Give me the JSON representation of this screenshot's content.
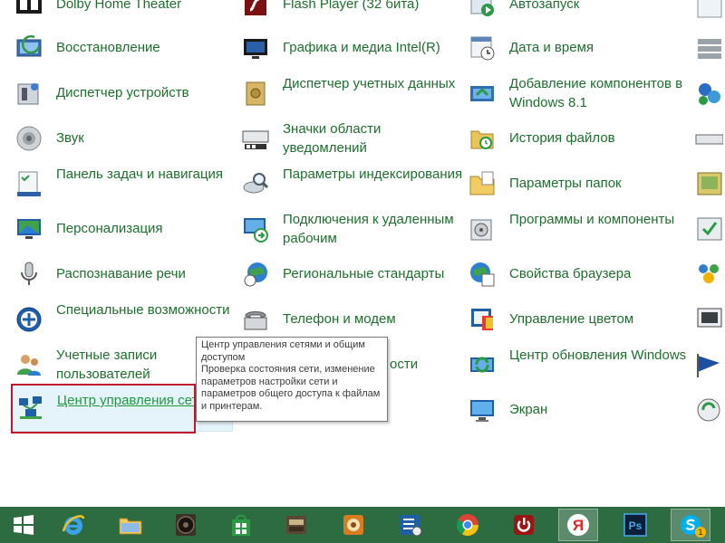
{
  "control_panel": {
    "items": {
      "dolby": "Dolby Home Theater",
      "flash": "Flash Player (32 бита)",
      "autoplay": "Автозапуск",
      "recovery": "Восстановление",
      "intel_graphics": "Графика и медиа Intel(R)",
      "date_time": "Дата и время",
      "device_manager": "Диспетчер устройств",
      "credential_manager": "Диспетчер учетных данных",
      "add_features": "Добавление компонентов в Windows 8.1",
      "sound": "Звук",
      "notification_icons": "Значки области уведомлений",
      "file_history": "История файлов",
      "taskbar_nav": "Панель задач и навигация",
      "indexing": "Параметры индексирования",
      "folder_options": "Параметры папок",
      "personalization": "Персонализация",
      "remote_connections": "Подключения к удаленным рабочим",
      "programs": "Программы и компоненты",
      "speech": "Распознавание речи",
      "regional": "Региональные стандарты",
      "browser": "Свойства браузера",
      "accessibility": "Специальные возможности",
      "phone_modem": "Телефон и модем",
      "color_management": "Управление цветом",
      "user_accounts": "Учетные записи пользователей",
      "hidden_item_tail": "ости",
      "windows_update": "Центр обновления Windows",
      "network_center": "Центр управления сетями и общим доступом",
      "screen": "Экран"
    },
    "tooltip": {
      "title": "Центр управления сетями и общим доступом",
      "description": "Проверка состояния сети, изменение параметров настройки сети и параметров общего доступа к файлам и принтерам."
    }
  },
  "taskbar": {
    "apps": [
      {
        "name": "start-button",
        "icon": "windows-logo-icon"
      },
      {
        "name": "internet-explorer",
        "icon": "internet-explorer-icon"
      },
      {
        "name": "file-explorer",
        "icon": "folder-icon"
      },
      {
        "name": "speaker-app",
        "icon": "speaker-icon"
      },
      {
        "name": "windows-store",
        "icon": "store-icon"
      },
      {
        "name": "doc-app",
        "icon": "doc-icon"
      },
      {
        "name": "media-app",
        "icon": "media-icon"
      },
      {
        "name": "control-panel",
        "icon": "control-panel-icon"
      },
      {
        "name": "chrome",
        "icon": "chrome-icon"
      },
      {
        "name": "power-app",
        "icon": "power-icon"
      },
      {
        "name": "yandex",
        "icon": "yandex-icon"
      },
      {
        "name": "photoshop",
        "icon": "photoshop-icon"
      },
      {
        "name": "skype",
        "icon": "skype-icon"
      }
    ],
    "ps_label": "Ps",
    "skype_badge": "1",
    "yandex_letter": "Я"
  },
  "colors": {
    "link_text": "#1e6f2e",
    "hover_link": "#1e9a3c",
    "taskbar_bg": "#2d6b40",
    "focus_outline": "#c0172f"
  }
}
